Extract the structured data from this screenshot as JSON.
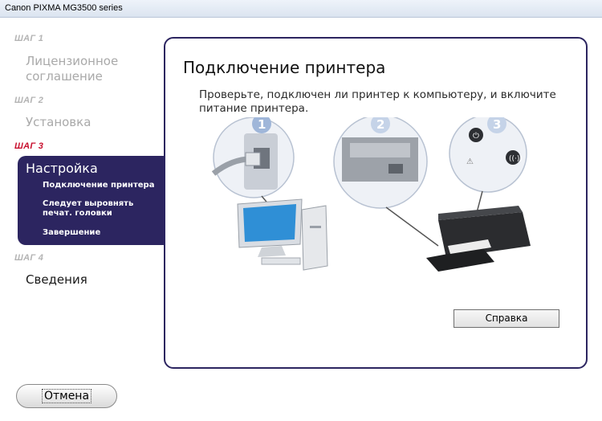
{
  "window": {
    "title": "Canon PIXMA MG3500 series"
  },
  "sidebar": {
    "step1": {
      "label": "ШАГ 1",
      "title": "Лицензионное соглашение"
    },
    "step2": {
      "label": "ШАГ 2",
      "title": "Установка"
    },
    "step3": {
      "label": "ШАГ 3",
      "title": "Настройка",
      "items": [
        "Подключение принтера",
        "Следует выровнять печат. головки",
        "Завершение"
      ]
    },
    "step4": {
      "label": "ШАГ 4",
      "title": "Сведения"
    }
  },
  "main": {
    "title": "Подключение принтера",
    "description": "Проверьте, подключен ли принтер к компьютеру, и включите питание принтера.",
    "callouts": [
      "1",
      "2",
      "3"
    ],
    "help_label": "Справка"
  },
  "footer": {
    "cancel_label": "Отмена"
  },
  "colors": {
    "accent": "#2c2560",
    "active_step": "#c8102e",
    "inactive": "#a9a9a9",
    "callout": "#9fb6d9"
  }
}
